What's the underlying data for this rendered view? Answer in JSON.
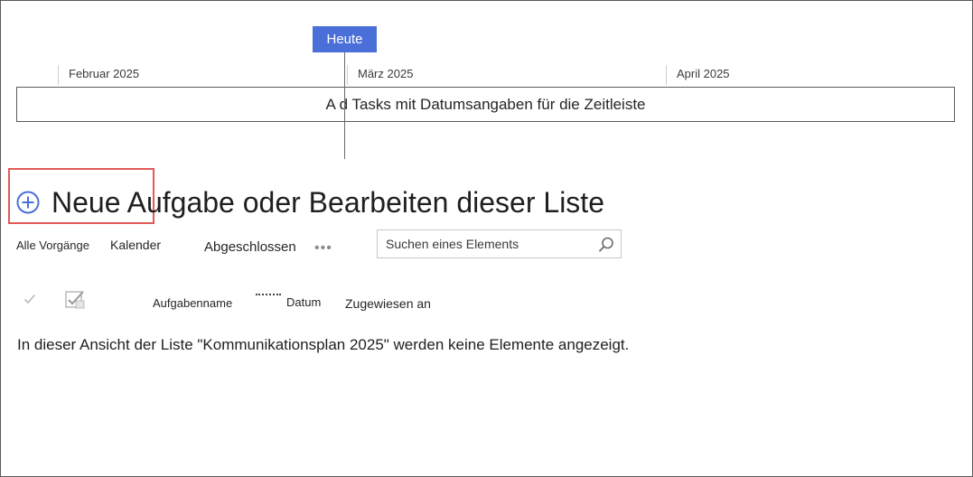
{
  "timeline": {
    "today_label": "Heute",
    "months": [
      "Februar 2025",
      "März 2025",
      "April 2025"
    ],
    "placeholder": "A d Tasks mit Datumsangaben für die Zeitleiste"
  },
  "heading": {
    "title": "Neue Aufgabe oder Bearbeiten dieser Liste"
  },
  "views": {
    "all_tasks": "Alle Vorgänge",
    "calendar": "Kalender",
    "completed": "Abgeschlossen",
    "more": "•••"
  },
  "search": {
    "placeholder": "Suchen eines Elements"
  },
  "columns": {
    "task_name": "Aufgabenname",
    "date": "Datum",
    "assigned_to": "Zugewiesen an"
  },
  "list": {
    "empty_message": "In dieser Ansicht der Liste \"Kommunikationsplan 2025\" werden keine Elemente angezeigt."
  },
  "colors": {
    "today_marker": "#4a6fd8",
    "highlight_border": "#e05a5a",
    "add_icon": "#4a6fd8"
  }
}
